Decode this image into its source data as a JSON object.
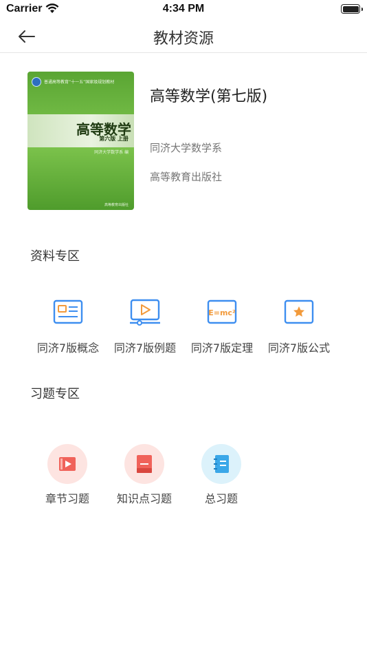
{
  "status_bar": {
    "carrier": "Carrier",
    "time": "4:34 PM"
  },
  "nav": {
    "title": "教材资源"
  },
  "book": {
    "title": "高等数学(第七版)",
    "author": "同济大学数学系",
    "publisher": "高等教育出版社",
    "cover": {
      "series": "普通高等教育“十一五”国家级规划教材",
      "title": "高等数学",
      "edition": "第六版 上册",
      "author": "同济大学数学系 编",
      "publisher": "高等教育出版社"
    }
  },
  "resources": {
    "title": "资料专区",
    "items": [
      {
        "label": "同济7版概念",
        "icon": "concept-card-icon"
      },
      {
        "label": "同济7版例题",
        "icon": "video-play-icon"
      },
      {
        "label": "同济7版定理",
        "icon": "formula-emc2-icon"
      },
      {
        "label": "同济7版公式",
        "icon": "star-card-icon"
      }
    ]
  },
  "exercises": {
    "title": "习题专区",
    "items": [
      {
        "label": "章节习题",
        "icon": "chapter-video-icon"
      },
      {
        "label": "知识点习题",
        "icon": "knowledge-book-icon"
      },
      {
        "label": "总习题",
        "icon": "notebook-icon"
      }
    ]
  },
  "colors": {
    "accent_blue": "#3d8ef0",
    "accent_orange": "#f29a3b",
    "red_icon": "#f0625a",
    "blue_icon": "#3aa7e8"
  }
}
